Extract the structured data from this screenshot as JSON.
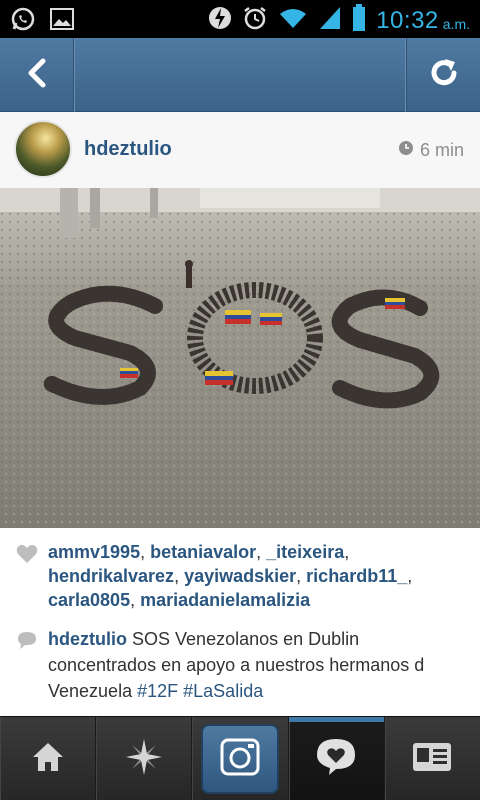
{
  "status_bar": {
    "time": "10:32",
    "ampm": "a.m.",
    "icons": [
      "whatsapp-icon",
      "gallery-icon",
      "flash-icon",
      "alarm-icon",
      "wifi-icon",
      "signal-icon",
      "battery-icon"
    ]
  },
  "navbar": {
    "back_icon": "chevron-left-icon",
    "refresh_icon": "refresh-icon"
  },
  "post": {
    "username": "hdeztulio",
    "time_ago": "6 min",
    "image": "photo of people forming SOS letters in a plaza"
  },
  "likes": {
    "users": [
      "ammv1995",
      "betaniavalor",
      "_iteixeira",
      "hendrikalvarez",
      "yayiwadskier",
      "richardb11_",
      "carla0805",
      "mariadanielamalizia"
    ]
  },
  "caption": {
    "username": "hdeztulio",
    "text": "SOS Venezolanos en Dublin concentrados en apoyo a nuestros hermanos d Venezuela",
    "hashtags": [
      "#12F",
      "#LaSalida"
    ]
  },
  "tabs": [
    {
      "name": "home",
      "icon": "home-icon"
    },
    {
      "name": "explore",
      "icon": "compass-star-icon"
    },
    {
      "name": "camera",
      "icon": "camera-icon"
    },
    {
      "name": "activity",
      "icon": "heart-bubble-icon"
    },
    {
      "name": "profile",
      "icon": "profile-card-icon"
    }
  ],
  "colors": {
    "navbar": "#4f7aa2",
    "link": "#2a5680",
    "status_time": "#35b5e5",
    "active_tab_indicator": "#3f78a8"
  }
}
